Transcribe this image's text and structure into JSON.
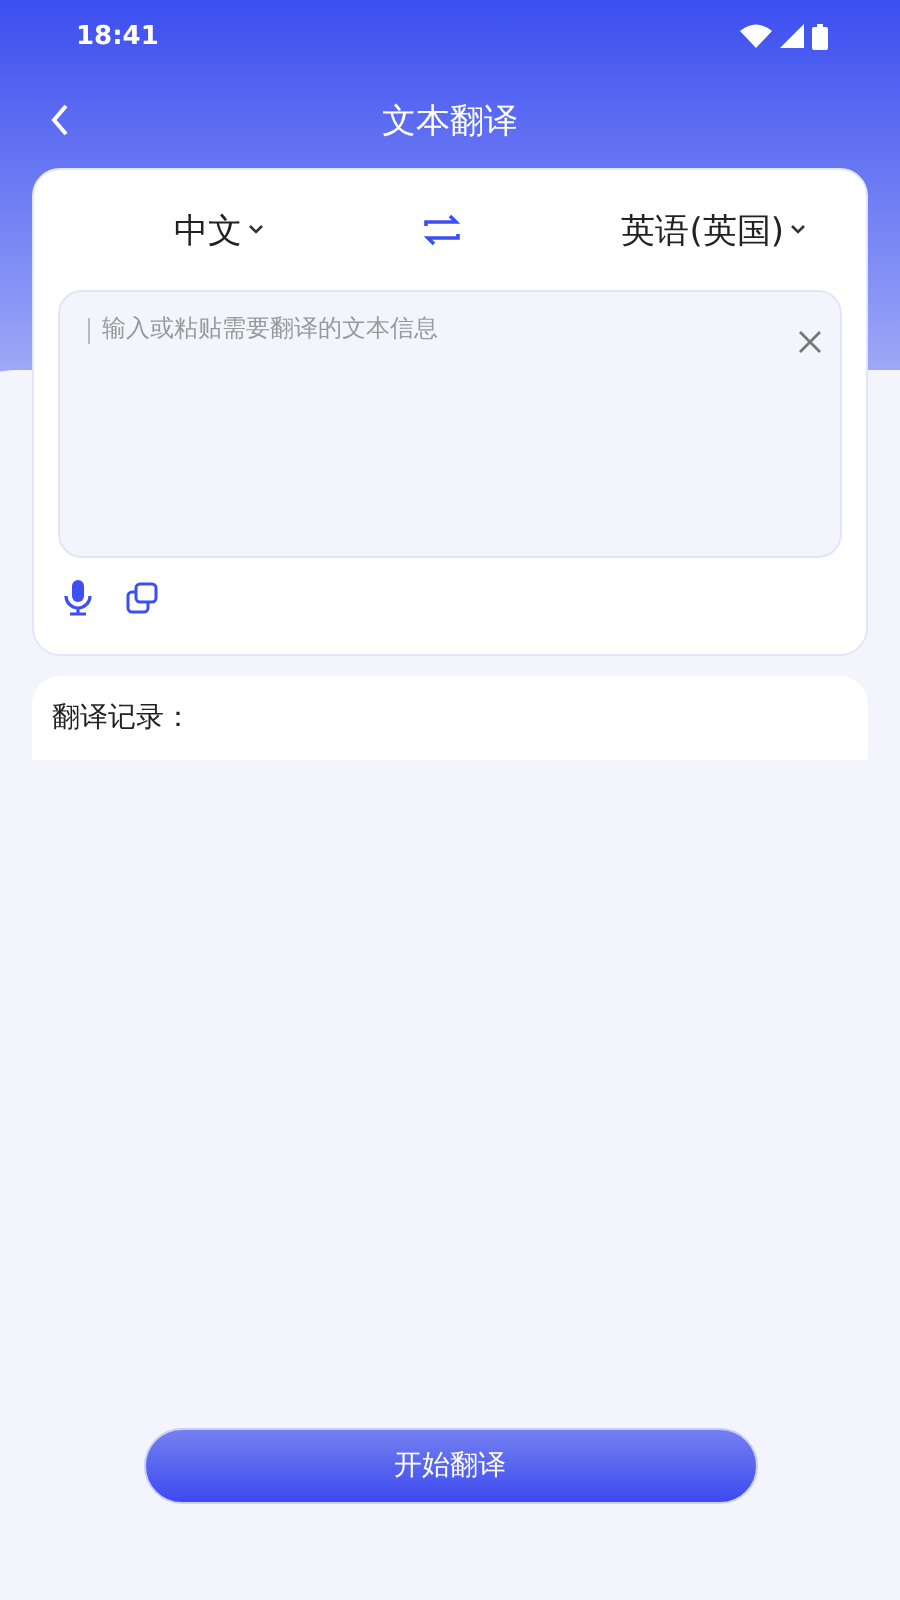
{
  "status_bar": {
    "time": "18:41"
  },
  "header": {
    "title": "文本翻译"
  },
  "languages": {
    "source": "中文",
    "target": "英语(英国)"
  },
  "input": {
    "placeholder": "输入或粘贴需要翻译的文本信息"
  },
  "history": {
    "title": "翻译记录："
  },
  "action": {
    "label": "开始翻译"
  }
}
